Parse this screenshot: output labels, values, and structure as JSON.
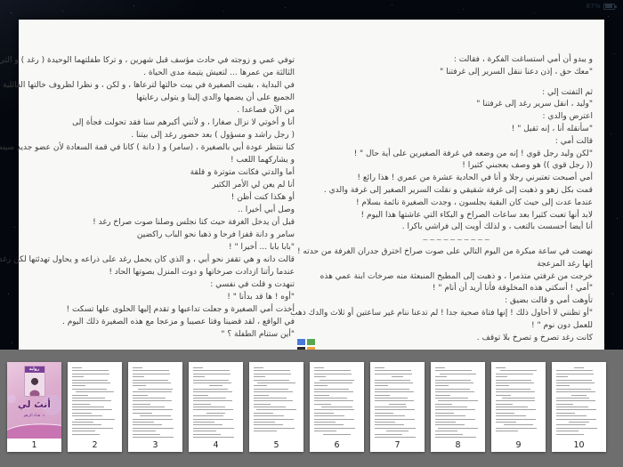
{
  "status_bar": {
    "battery_percent": "87%"
  },
  "reader": {
    "left_page": {
      "lines": [
        "توفي عمي و زوجته في حادث مؤسف قبل شهرين ، و تركا طفلتهما الوحيدة ( رغد ) و التي تقترب من",
        "الثالثة من عمرها ... لتعيش يتيمة مدى الحياة .",
        "في البداية ، بقيت الصغيرة في بيت خالتها لترعاها ، و لكن ، و نظرا لظروف خالتها العائلية ، اتفق",
        "الجميع على أن يضمها والدي إلينا و يتولى رعايتها",
        "من الآن فصاعدا .",
        "أنا و أخوتي لا نزال صغارا ، و لأنني أكبرهم سنا فقد تحولت فجأة إلى",
        "( رجل راشد و مسؤول ) بعد حضور رغد إلى بيتنا .",
        "كنا ننتظر عودة أبي بالصغيرة ، (سامر) و ( دانة ) كانا في قمة السعادة لأن عضو جديد سينضم إليهما",
        "و يشاركهما اللعب !",
        "أما والدتي فكانت متوترة و قلقة",
        "أنا لم يعن لي الأمر الكثير",
        "أو هكذا كنت أظن !",
        "وصل أبي أخيرا ..",
        "قبل أن يدخل الغرفة حيث كنا نجلس وصلنا صوت صراخ رغد !",
        "سامر و دانة قفزا فرحا و ذهبا نحو الباب راكضين",
        "\"بابا بابا ... أخيرا \" !",
        "قالت دانه و هي تقفز نحو أبي ، و الذي كان يحمل رغد على ذراعه و يحاول تهدئتها لكن رغد",
        "عندما رأتنا ازدادت صرخاتها و دوت المنزل بصوتها الحاد !",
        "تنهدت و قلت في نفسي :",
        "\"أوه ! ها قد بدأنا \" !",
        "أخذت أمي الصغيرة و جعلت تداعبها و تقدم إليها الحلوى علها تسكت !",
        "في الواقع ، لقد قضينا وقتا عصيبا و مزعجا مع هذه الصغيرة ذلك اليوم .",
        "\"أين ستنام الطفلة ؟ \""
      ]
    },
    "right_page": {
      "lines": [
        "و يبدو أن أمي استساغت الفكرة ، فقالت :",
        "\"معك حق ، إذن دعنا ننقل السرير إلى غرفتنا \"",
        "",
        "ثم التفتت إلي :",
        "\"وليد ، انقل سرير رغد إلى غرفتنا \"",
        "اعترض والدي :",
        "\"سأنقله أنا ، إنه ثقيل \" !",
        "قالت أمي :",
        "\"لكن وليد رجل قوي ! إنه من وضعه في غرفة الصغيرين على أية حال \" !",
        "(( رجل قوي )) هو وصف يعجبني كثيرا !",
        "أمي أصبحت تعتبرني رجلا و أنا في الحادية عشرة من عمري ! هذا رائع !",
        "قمت بكل زهو و ذهبت إلى غرفة شقيقي و نقلت السرير الصغير إلى غرفة والدي .",
        "عندما عدت إلى حيث كان البقية يجلسون ، وجدت الصغيرة نائمة بسلام !",
        "لابد أنها تعبت كثيرا بعد ساعات الصراخ و البكاء التي عاشتها هذا اليوم !",
        "أنا أيضا أحسست بالتعب ، و لذلك أويت إلى فراشي باكرا .",
        "~~~~~~~~~~",
        "نهضت في ساعة مبكرة من اليوم التالي على صوت صراخ اخترق جدران الغرفة من حدته !",
        "إنها رغد المزعجة",
        "خرجت من غرفتي متذمرا ، و ذهبت إلى المطبخ المنبعثة منه صرخات ابنة عمي هذه",
        "\"أمي ! أسكتي هذه المخلوقة فأنا أريد أن أنام \" !",
        "تأوهت أمي و قالت بضيق :",
        "\"أو تظنني لا أحاول ذلك ! إنها فتاة صحية جدا ! لم تدعنا ننام غير ساعتين أو ثلاث والدك ذهب",
        "للعمل دون نوم \" !",
        "كانت رغد تصرخ و تصرخ بلا توقف ."
      ]
    }
  },
  "publisher_logo": {
    "colors": [
      "#4a79d9",
      "#58a74f",
      "#2a2a2a",
      "#f0a23c"
    ]
  },
  "thumbnail_bar": {
    "cover": {
      "badge": "رواية",
      "title": "أنتَ لي",
      "author": "د. هناء الرهو"
    },
    "pages": [
      {
        "number": "1",
        "type": "cover"
      },
      {
        "number": "2",
        "type": "text"
      },
      {
        "number": "3",
        "type": "text"
      },
      {
        "number": "4",
        "type": "text"
      },
      {
        "number": "5",
        "type": "text"
      },
      {
        "number": "6",
        "type": "text"
      },
      {
        "number": "7",
        "type": "text"
      },
      {
        "number": "8",
        "type": "text"
      },
      {
        "number": "9",
        "type": "text"
      },
      {
        "number": "10",
        "type": "text"
      }
    ]
  },
  "colors": {
    "cover_pink": "#dcadce",
    "title_purple": "#5c2170",
    "strip_gray": "#6e6e6e"
  }
}
